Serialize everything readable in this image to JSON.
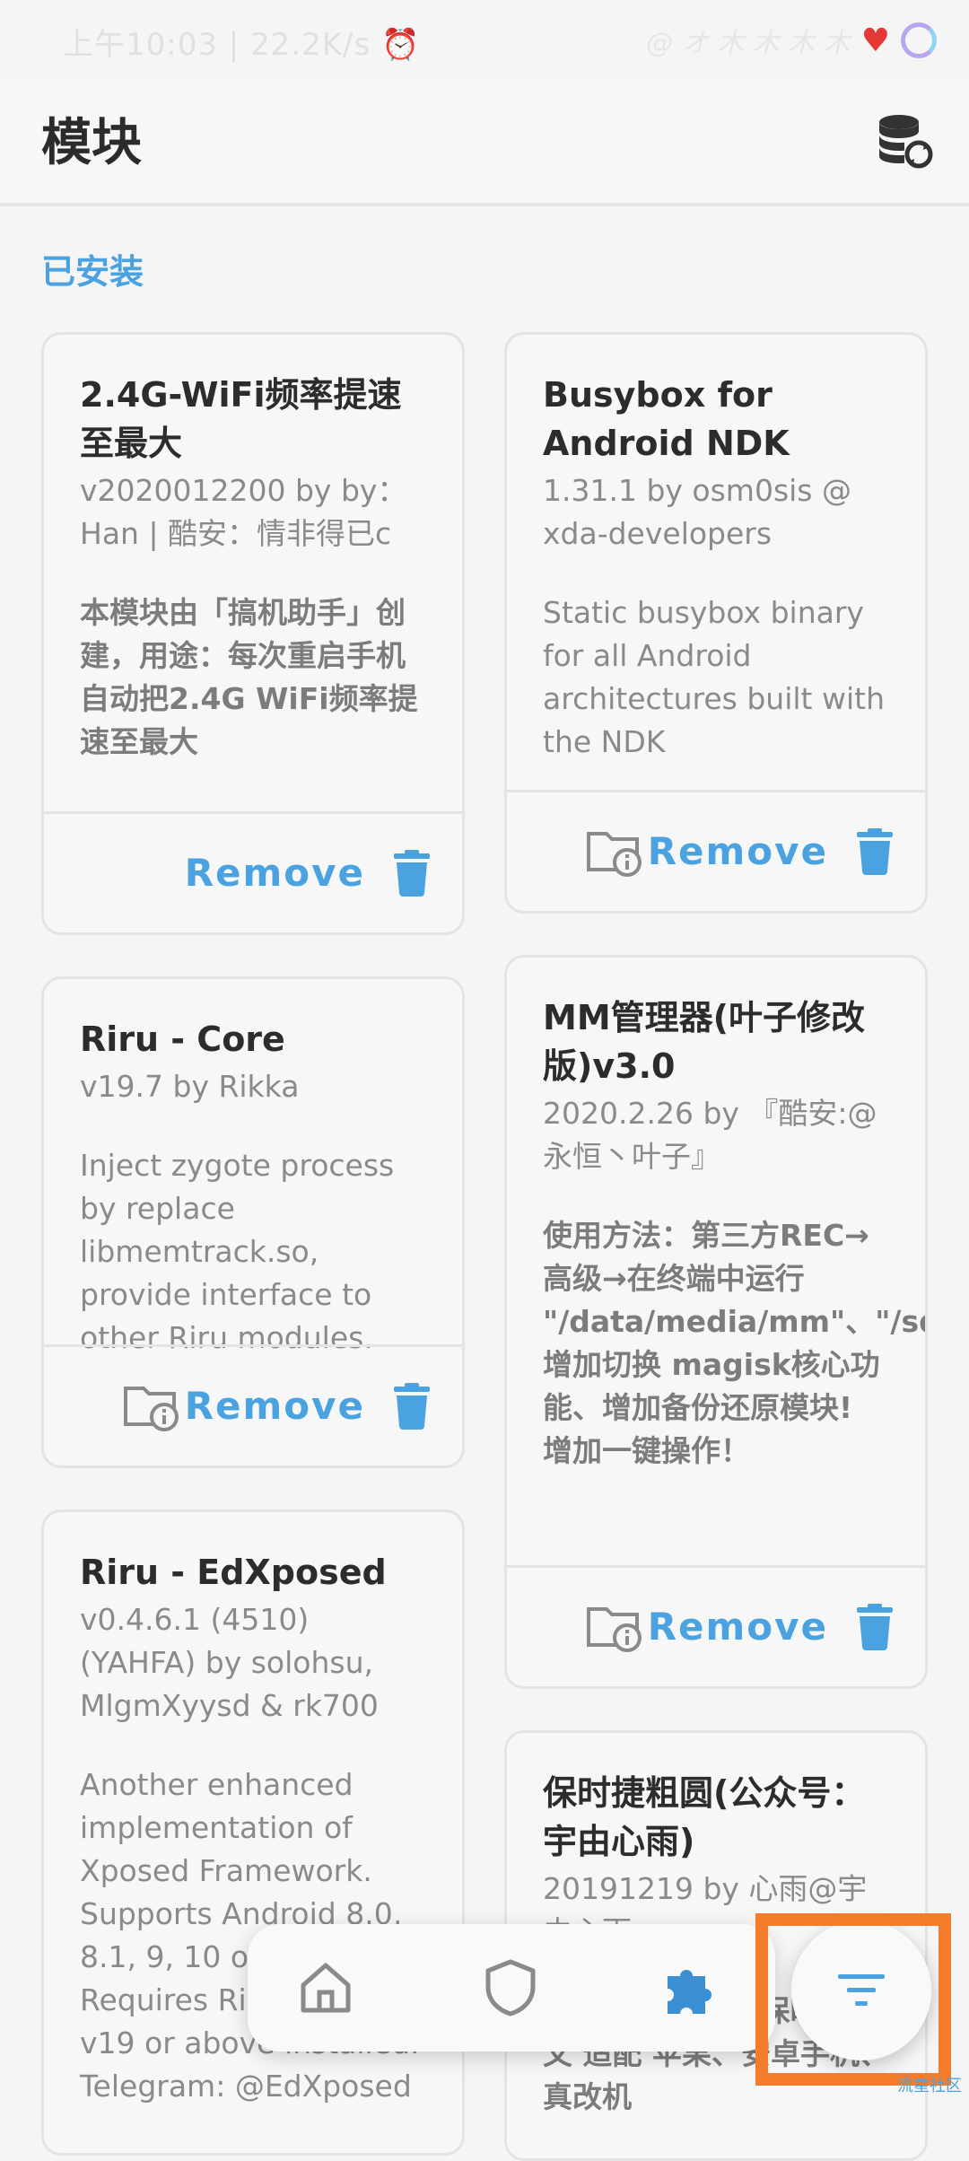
{
  "status": {
    "left": "上午10:03 | 22.2K/s ⏰",
    "right_sig": "@ オ 木 木 木 木"
  },
  "header": {
    "title": "模块"
  },
  "section": {
    "installed": "已安装"
  },
  "modules": [
    {
      "title": "2.4G-WiFi频率提速至最大",
      "sub": "v2020012200 by by：Han | 酷安：情非得已c",
      "desc": "本模块由「搞机助手」创建，用途：每次重启手机自动把2.4G WiFi频率提速至最大",
      "remove": "Remove"
    },
    {
      "title": "Busybox for Android NDK",
      "sub": "1.31.1 by osm0sis @ xda-developers",
      "desc": "Static busybox binary for all Android architectures built with the NDK",
      "remove": "Remove"
    },
    {
      "title": "Riru - Core",
      "sub": "v19.7 by Rikka",
      "desc": "Inject zygote process by replace libmemtrack.so, provide interface to other Riru modules.",
      "remove": "Remove"
    },
    {
      "title": "MM管理器(叶子修改版)v3.0",
      "sub": "2020.2.26 by 『酷安:@永恒丶叶子』",
      "desc": "使用方法：第三方REC→高级→在终端中运行 \"/data/media/mm\"、\"/sdcard/mm\"、\"*/mm\"、增加切换 magisk核心功能、增加备份还原模块! 增加一键操作！",
      "remove": "Remove"
    },
    {
      "title": "Riru - EdXposed",
      "sub": "v0.4.6.1 (4510) (YAHFA) by solohsu, MlgmXyysd & rk700",
      "desc": "Another enhanced implementation of Xposed Framework. Supports Android 8.0, 8.1, 9, 10 or above. Requires Riru - Core v19 or above installed. Telegram: @EdXposed"
    },
    {
      "title": "保时捷粗圆(公众号：宇由心雨)",
      "sub": "20191219 by 心雨@宇由心雨",
      "desc": "方正保时捷 搭配保时捷英文 适配 苹果、安卓手机、真改机"
    }
  ],
  "watermark": "流星社区",
  "colors": {
    "accent": "#4aa3e0",
    "highlight": "#f57c2b"
  },
  "icons": {
    "appbar": "database-sync-icon",
    "nav": [
      "home-icon",
      "shield-icon",
      "puzzle-icon"
    ],
    "fab": "filter-icon"
  }
}
